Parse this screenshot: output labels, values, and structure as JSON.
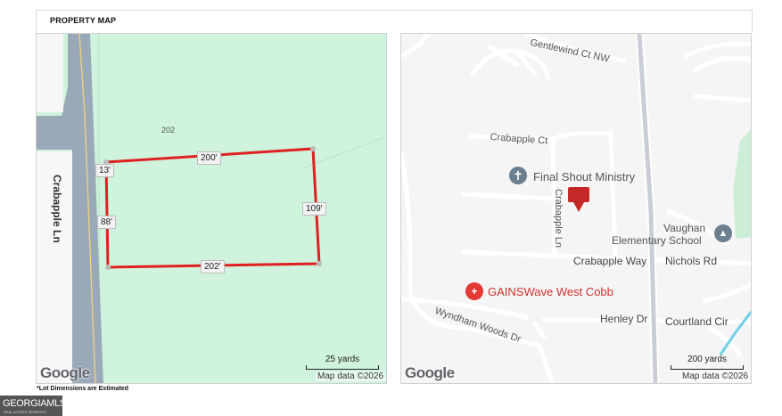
{
  "header": {
    "title": "PROPERTY MAP"
  },
  "parcel_map": {
    "lot_number": "202",
    "road_label": "Crabapple Ln",
    "dimensions": {
      "top": "200'",
      "bottom": "202'",
      "right": "109'",
      "left_upper": "13'",
      "left_lower": "88'"
    },
    "scale_label": "25 yards",
    "attribution": "Map data ©2026",
    "logo": "Google",
    "colors": {
      "parcel_fill": "#cff3dd",
      "lot_line": "#e02020",
      "road": "#9aa9b8"
    }
  },
  "area_map": {
    "streets": {
      "gentlewind": "Gentlewind Ct NW",
      "crabapple_ct": "Crabapple Ct",
      "crabapple_ln": "Crabapple Ln",
      "crabapple_way": "Crabapple Way",
      "nichols": "Nichols Rd",
      "wyndham": "Wyndham Woods Dr",
      "henley": "Henley Dr",
      "courtland": "Courtland Cir"
    },
    "places": {
      "church": "Final Shout Ministry",
      "school_line1": "Vaughan",
      "school_line2": "Elementary School",
      "business": "GAINSWave West Cobb"
    },
    "icons": [
      "cross-icon",
      "school-icon",
      "medical-icon",
      "location-pin-icon"
    ],
    "scale_label": "200 yards",
    "attribution": "Map data ©2026",
    "logo": "Google",
    "colors": {
      "marker": "#c62828",
      "business": "#d32f2f",
      "water": "#6fd0ea"
    }
  },
  "footnote": "*Lot Dimensions are Estimated",
  "brand": {
    "name": "GEORGIAMLS",
    "tagline": "REAL ESTATE SERVICES"
  }
}
